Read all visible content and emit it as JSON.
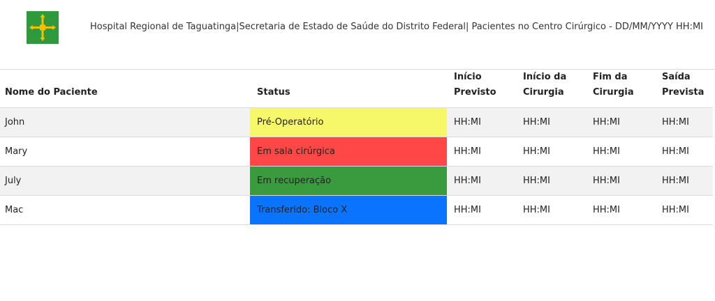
{
  "header": {
    "title": "Hospital Regional de Taguatinga|Secretaria de Estado de Saúde do Distrito Federal| Pacientes no Centro Cirúrgico - DD/MM/YYYY HH:MI",
    "logo_icon": "distrito-federal-flag-icon",
    "logo_colors": {
      "field": "#2e9a3c",
      "cross": "#f2c200"
    }
  },
  "table": {
    "columns": [
      "Nome do Paciente",
      "Status",
      "Início Previsto",
      "Início da Cirurgia",
      "Fim da Cirurgia",
      "Saída Prevista"
    ],
    "rows": [
      {
        "name": "John",
        "status": "Pré-Operatório",
        "status_color": "#f7f76a",
        "inicio_previsto": "HH:MI",
        "inicio_cirurgia": "HH:MI",
        "fim_cirurgia": "HH:MI",
        "saida_prevista": "HH:MI"
      },
      {
        "name": "Mary",
        "status": "Em sala cirúrgica",
        "status_color": "#ff4747",
        "inicio_previsto": "HH:MI",
        "inicio_cirurgia": "HH:MI",
        "fim_cirurgia": "HH:MI",
        "saida_prevista": "HH:MI"
      },
      {
        "name": "July",
        "status": "Em recuperação",
        "status_color": "#3a9a3e",
        "inicio_previsto": "HH:MI",
        "inicio_cirurgia": "HH:MI",
        "fim_cirurgia": "HH:MI",
        "saida_prevista": "HH:MI"
      },
      {
        "name": "Mac",
        "status": "Transferido: Bloco X",
        "status_color": "#0a74ff",
        "inicio_previsto": "HH:MI",
        "inicio_cirurgia": "HH:MI",
        "fim_cirurgia": "HH:MI",
        "saida_prevista": "HH:MI"
      }
    ]
  }
}
